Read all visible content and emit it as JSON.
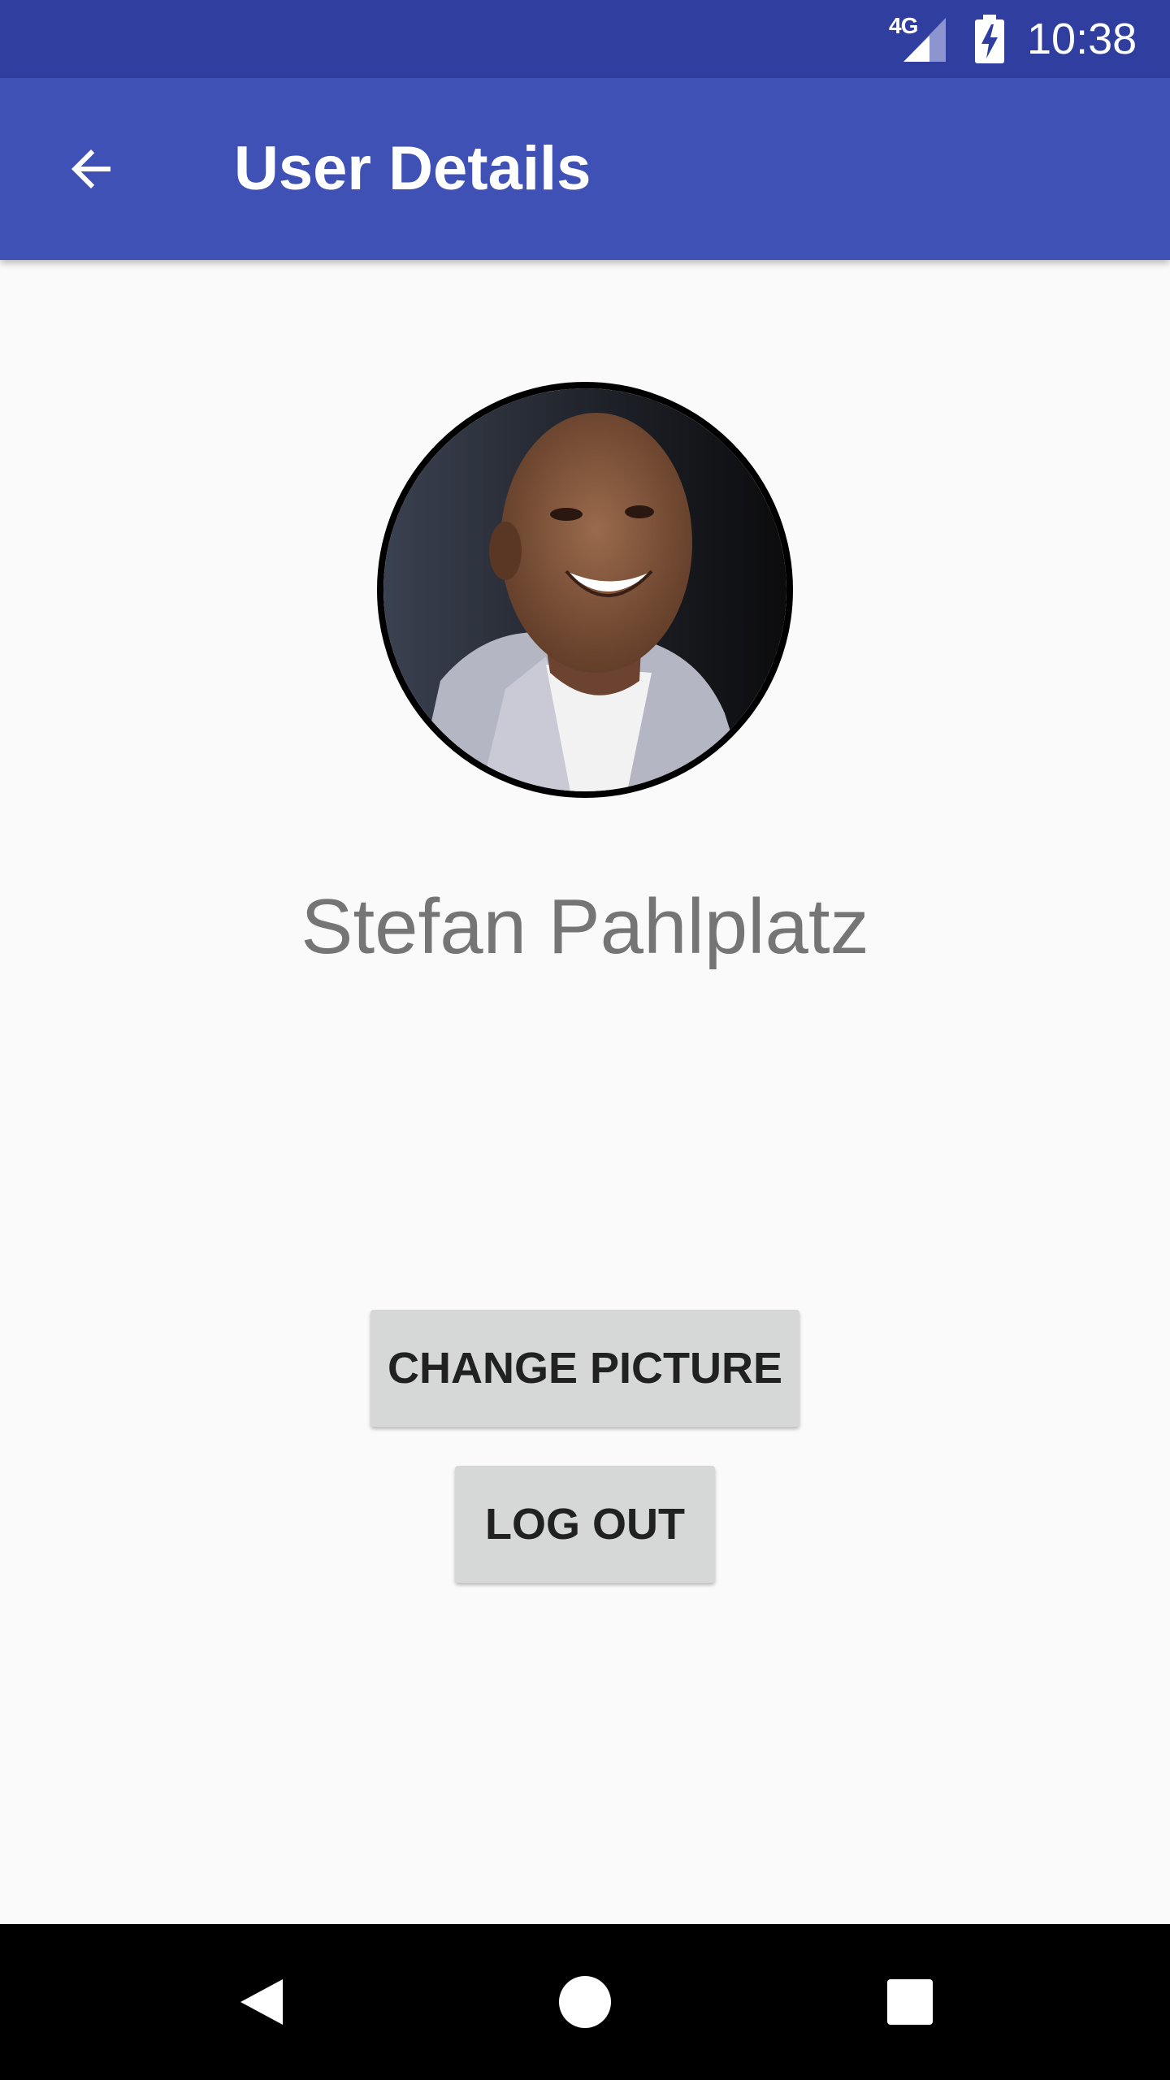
{
  "status_bar": {
    "network": "4G",
    "time": "10:38"
  },
  "app_bar": {
    "title": "User Details"
  },
  "profile": {
    "name": "Stefan Pahlplatz"
  },
  "actions": {
    "change_picture_label": "CHANGE PICTURE",
    "logout_label": "LOG OUT"
  },
  "colors": {
    "status_bar": "#303f9f",
    "app_bar": "#3f51b5",
    "background": "#fafafa",
    "button": "#d6d7d7"
  },
  "icons": {
    "back": "arrow-left-icon",
    "nav_back": "triangle-back-icon",
    "nav_home": "circle-home-icon",
    "nav_recents": "square-recents-icon"
  }
}
